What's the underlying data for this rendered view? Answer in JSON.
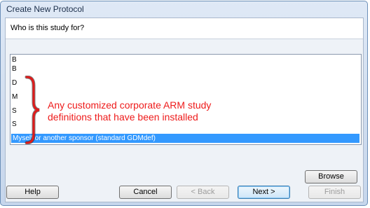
{
  "window": {
    "title": "Create New Protocol"
  },
  "prompt": {
    "question": "Who is this study for?"
  },
  "list": {
    "items": [
      {
        "label": "B",
        "selected": false
      },
      {
        "label": "B",
        "selected": false
      },
      {
        "label": "D",
        "selected": false
      },
      {
        "label": "M",
        "selected": false
      },
      {
        "label": "S",
        "selected": false
      },
      {
        "label": "S",
        "selected": false
      },
      {
        "label": "Myself or another sponsor (standard GDMdef)",
        "selected": true
      }
    ]
  },
  "annotation": {
    "line1": "Any customized corporate ARM study",
    "line2": "definitions that have been installed",
    "color": "#ee1b1b"
  },
  "buttons": {
    "browse": "Browse",
    "help": "Help",
    "cancel": "Cancel",
    "back": "< Back",
    "next": "Next >",
    "finish": "Finish"
  },
  "colors": {
    "selection": "#3399ff",
    "titlebar": "#dfe9f6"
  }
}
